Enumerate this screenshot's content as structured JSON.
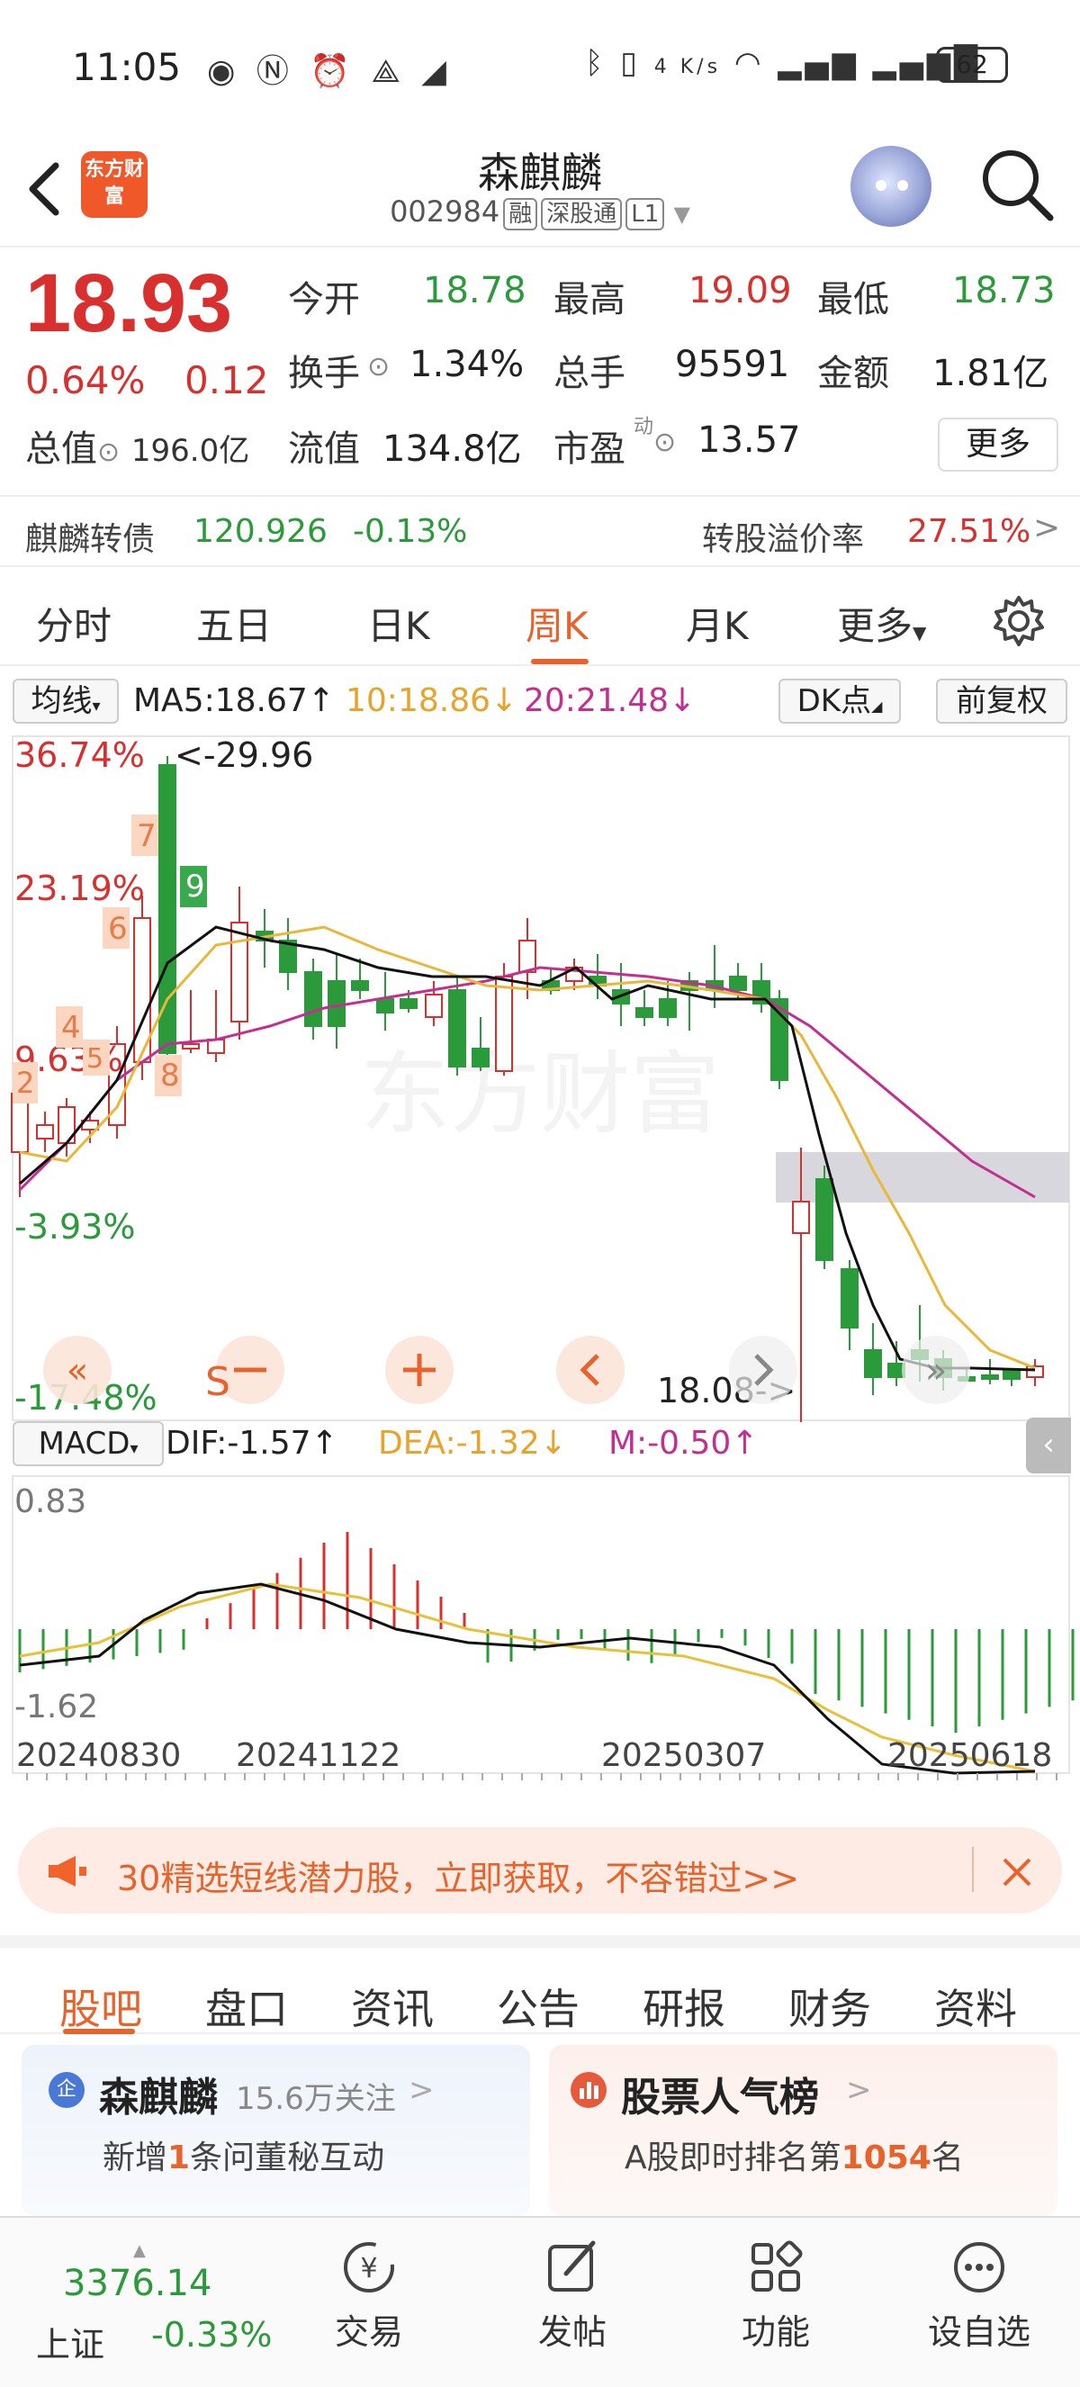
{
  "status_bar": {
    "time": "11:05",
    "net_speed": "4 K/s",
    "battery": "62"
  },
  "header": {
    "logo_text": "东方财富",
    "stock_name": "森麒麟",
    "stock_code": "002984",
    "tags": [
      "融",
      "深股通",
      "L1"
    ]
  },
  "quote": {
    "price": "18.93",
    "change_pct": "0.64%",
    "change_abs": "0.12",
    "fields": [
      {
        "label": "今开",
        "value": "18.78",
        "color": "#2a9a3a"
      },
      {
        "label": "最高",
        "value": "19.09",
        "color": "#d8302e"
      },
      {
        "label": "最低",
        "value": "18.73",
        "color": "#2a9a3a"
      },
      {
        "label": "换手",
        "value": "1.34%",
        "color": "#222222"
      },
      {
        "label": "总手",
        "value": "95591",
        "color": "#222222"
      },
      {
        "label": "金额",
        "value": "1.81亿",
        "color": "#222222"
      },
      {
        "label": "流值",
        "value": "134.8亿",
        "color": "#222222"
      },
      {
        "label": "市盈",
        "value": "13.57",
        "color": "#222222"
      }
    ],
    "total_value_label": "总值",
    "total_value": "196.0亿",
    "pe_superscript": "动",
    "more_label": "更多"
  },
  "convertible": {
    "name": "麒麟转债",
    "price": "120.926",
    "change": "-0.13%",
    "premium_label": "转股溢价率",
    "premium": "27.51%"
  },
  "period_tabs": [
    "分时",
    "五日",
    "日K",
    "周K",
    "月K",
    "更多"
  ],
  "active_period": "周K",
  "ma_row": {
    "ma_label": "均线",
    "ma5": "MA5:18.67",
    "ma10": "10:18.86",
    "ma20": "20:21.48",
    "dk_label": "DK点",
    "adjust_label": "前复权"
  },
  "chart_labels": {
    "y_top": "36.74%",
    "y_2": "23.19%",
    "y_3": "9.63%",
    "y_4": "-3.93%",
    "y_bottom": "-17.48%",
    "max_marker": "<-29.96",
    "min_marker": "18.08->",
    "s_marker": "S",
    "signal_numbers": [
      "7",
      "6",
      "4",
      "5",
      "8",
      "2",
      "9"
    ]
  },
  "macd_row": {
    "label": "MACD",
    "dif": "DIF:-1.57",
    "dea": "DEA:-1.32",
    "m": "M:-0.50",
    "top": "0.83",
    "bottom": "-1.62"
  },
  "x_dates": [
    "20240830",
    "20241122",
    "20250307",
    "20250618"
  ],
  "chart_data": {
    "type": "candlestick",
    "title": "",
    "x_dates": [
      "20240830",
      "20241122",
      "20250307",
      "20250618"
    ],
    "y_labels_pct": [
      "36.74%",
      "23.19%",
      "9.63%",
      "-3.93%",
      "-17.48%"
    ],
    "ma": {
      "MA5": 18.67,
      "MA10": 18.86,
      "MA20": 21.48
    },
    "macd": {
      "DIF": -1.57,
      "DEA": -1.32,
      "M": -0.5,
      "ylim": [
        -1.62,
        0.83
      ]
    },
    "max_label": 29.96,
    "min_label": 18.08
  },
  "ad": {
    "text": "30精选短线潜力股，立即获取，不容错过>>"
  },
  "info_tabs": [
    "股吧",
    "盘口",
    "资讯",
    "公告",
    "研报",
    "财务",
    "资料"
  ],
  "active_info_tab": "股吧",
  "cards": {
    "left_title": "森麒麟",
    "left_follow": "15.6万关注",
    "left_sub_pre": "新增",
    "left_sub_num": "1",
    "left_sub_post": "条问董秘互动",
    "right_title": "股票人气榜",
    "right_sub_pre": "A股即时排名第",
    "right_sub_num": "1054",
    "right_sub_post": "名"
  },
  "bottom_nav": {
    "index_value": "3376.14",
    "index_name": "上证",
    "index_change": "-0.33%",
    "items": [
      "交易",
      "发帖",
      "功能",
      "设自选"
    ]
  }
}
